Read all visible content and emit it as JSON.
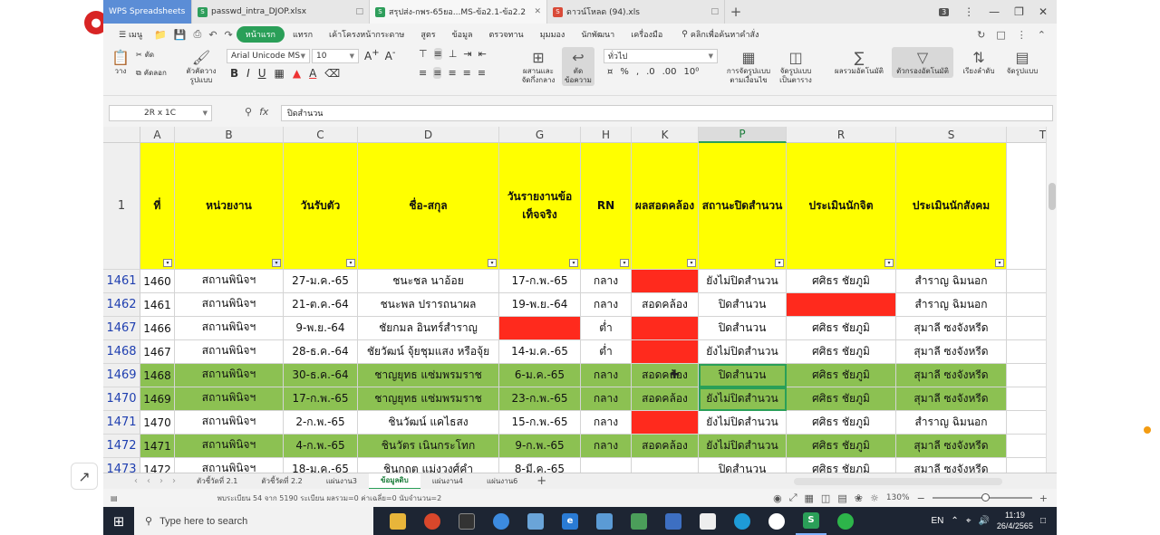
{
  "window": {
    "brand": "WPS Spreadsheets",
    "tabs": [
      {
        "label": "passwd_intra_DJOP.xlsx",
        "active": false
      },
      {
        "label": "สรุปส่ง-กพร-65ยอ...MS-ข้อ2.1-ข้อ2.2",
        "active": true
      },
      {
        "label": "ดาวน์โหลด (94).xls",
        "active": false
      }
    ],
    "window_badge": "3"
  },
  "menu": {
    "items": [
      "เมนู",
      "หน้าแรก",
      "แทรก",
      "เค้าโครงหน้ากระดาษ",
      "สูตร",
      "ข้อมูล",
      "ตรวจทาน",
      "มุมมอง",
      "นักพัฒนา",
      "เครื่องมือ"
    ],
    "active": "หน้าแรก",
    "search_label": "คลิกเพื่อค้นหาคำสั่ง"
  },
  "ribbon": {
    "paste": "วาง",
    "cut": "ตัด",
    "copy": "คัดลอก",
    "format_painter": "ตัวคัดวาง\nรูปแบบ",
    "font_name": "Arial Unicode MS",
    "font_size": "10",
    "merge_center": "ผสานและ\nจัดกึ่งกลาง",
    "wrap_text": "ตัด\nข้อความ",
    "number_format": "ทั่วไป",
    "cond_format": "การจัดรูปแบบ\nตามเงื่อนไข",
    "table_format": "จัดรูปแบบ\nเป็นตาราง",
    "autosum": "ผลรวมอัตโนมัติ",
    "autofilter": "ตัวกรองอัตโนมัติ",
    "sort": "เรียงลำดับ",
    "format": "จัดรูปแบบ"
  },
  "formula_bar": {
    "name_box": "2R x 1C",
    "fx": "fx",
    "content": "ปิดสำนวน"
  },
  "columns": [
    "A",
    "B",
    "C",
    "D",
    "G",
    "H",
    "K",
    "P",
    "R",
    "S",
    "T"
  ],
  "header_row": {
    "row_number": "1",
    "cells": [
      "ที่",
      "หน่วยงาน",
      "วันรับตัว",
      "ชื่อ-สกุล",
      "วันรายงานข้อเท็จจริง",
      "RN",
      "ผลสอดคล้อง",
      "สถานะปิดสำนวน",
      "ประเมินนักจิต",
      "ประเมินนักสังคม"
    ]
  },
  "rows": [
    {
      "rn": "1461",
      "a": "1460",
      "b": "สถานพินิจฯ",
      "c": "27-ม.ค.-65",
      "d": "ชนะชล นาอ้อย",
      "g": "17-ก.พ.-65",
      "h": "กลาง",
      "k": "",
      "p": "ยังไม่ปิดสำนวน",
      "r": "ศศิธร ชัยภูมิ",
      "s": "สำราญ ฉิมนอก",
      "fill": "white",
      "red": [
        "k"
      ]
    },
    {
      "rn": "1462",
      "a": "1461",
      "b": "สถานพินิจฯ",
      "c": "21-ต.ค.-64",
      "d": "ชนะพล ปรารถนาผล",
      "g": "19-พ.ย.-64",
      "h": "กลาง",
      "k": "สอดคล้อง",
      "p": "ปิดสำนวน",
      "r": "",
      "s": "สำราญ ฉิมนอก",
      "fill": "white",
      "red": [
        "r"
      ]
    },
    {
      "rn": "1467",
      "a": "1466",
      "b": "สถานพินิจฯ",
      "c": "9-พ.ย.-64",
      "d": "ชัยกมล อินทร์สำราญ",
      "g": "",
      "h": "ต่ำ",
      "k": "",
      "p": "ปิดสำนวน",
      "r": "ศศิธร ชัยภูมิ",
      "s": "สุมาลี ซงจังหรีด",
      "fill": "white",
      "red": [
        "g",
        "k"
      ]
    },
    {
      "rn": "1468",
      "a": "1467",
      "b": "สถานพินิจฯ",
      "c": "28-ธ.ค.-64",
      "d": "ชัยวัฒน์ จุ้ยชุมแสง หรือจุ้ย",
      "g": "14-ม.ค.-65",
      "h": "ต่ำ",
      "k": "",
      "p": "ยังไม่ปิดสำนวน",
      "r": "ศศิธร ชัยภูมิ",
      "s": "สุมาลี ซงจังหรีด",
      "fill": "white",
      "red": [
        "k"
      ]
    },
    {
      "rn": "1469",
      "a": "1468",
      "b": "สถานพินิจฯ",
      "c": "30-ธ.ค.-64",
      "d": "ชาญยุทธ แซ่มพรมราช",
      "g": "6-ม.ค.-65",
      "h": "กลาง",
      "k": "สอดคล้อง",
      "p": "ปิดสำนวน",
      "r": "ศศิธร ชัยภูมิ",
      "s": "สุมาลี ซงจังหรีด",
      "fill": "green",
      "red": []
    },
    {
      "rn": "1470",
      "a": "1469",
      "b": "สถานพินิจฯ",
      "c": "17-ก.พ.-65",
      "d": "ชาญยุทธ แซ่มพรมราช",
      "g": "23-ก.พ.-65",
      "h": "กลาง",
      "k": "สอดคล้อง",
      "p": "ยังไม่ปิดสำนวน",
      "r": "ศศิธร ชัยภูมิ",
      "s": "สุมาลี ซงจังหรีด",
      "fill": "green",
      "red": []
    },
    {
      "rn": "1471",
      "a": "1470",
      "b": "สถานพินิจฯ",
      "c": "2-ก.พ.-65",
      "d": "ชินวัฒน์ แคไธสง",
      "g": "15-ก.พ.-65",
      "h": "กลาง",
      "k": "",
      "p": "ยังไม่ปิดสำนวน",
      "r": "ศศิธร ชัยภูมิ",
      "s": "สำราญ ฉิมนอก",
      "fill": "white",
      "red": [
        "k"
      ]
    },
    {
      "rn": "1472",
      "a": "1471",
      "b": "สถานพินิจฯ",
      "c": "4-ก.พ.-65",
      "d": "ชินวัตร เนินกระโทก",
      "g": "9-ก.พ.-65",
      "h": "กลาง",
      "k": "สอดคล้อง",
      "p": "ยังไม่ปิดสำนวน",
      "r": "ศศิธร ชัยภูมิ",
      "s": "สุมาลี ซงจังหรีด",
      "fill": "green",
      "red": []
    },
    {
      "rn": "1473",
      "a": "1472",
      "b": "สถานพินิจฯ",
      "c": "18-ม.ค.-65",
      "d": "ชินกฤต แม่งวงศ์คำ",
      "g": "8-มี.ค.-65",
      "h": "",
      "k": "",
      "p": "ปิดสำนวน",
      "r": "ศศิธร ชัยภูมิ",
      "s": "สุมาลี ซงจังหรีด",
      "fill": "white",
      "red": []
    }
  ],
  "sheets": {
    "tabs": [
      "ตัวชี้วัดที่ 2.1",
      "ตัวชี้วัดที่ 2.2",
      "แผ่นงาน3",
      "ข้อมูลดิบ",
      "แผ่นงาน4",
      "แผ่นงาน6"
    ],
    "active": "ข้อมูลดิบ"
  },
  "status": {
    "text": "พบระเบียน 54 จาก 5190 ระเบียน     ผลรวม=0  ค่าเฉลี่ย=0  นับจำนวน=2",
    "zoom": "130%"
  },
  "taskbar": {
    "search_placeholder": "Type here to search",
    "lang": "EN",
    "time": "11:19",
    "date": "26/4/2565"
  },
  "colors": {
    "header_fill": "#ffff00",
    "green_fill": "#8cc152",
    "red_fill": "#ff2a1d",
    "accent": "#2a9f58"
  }
}
